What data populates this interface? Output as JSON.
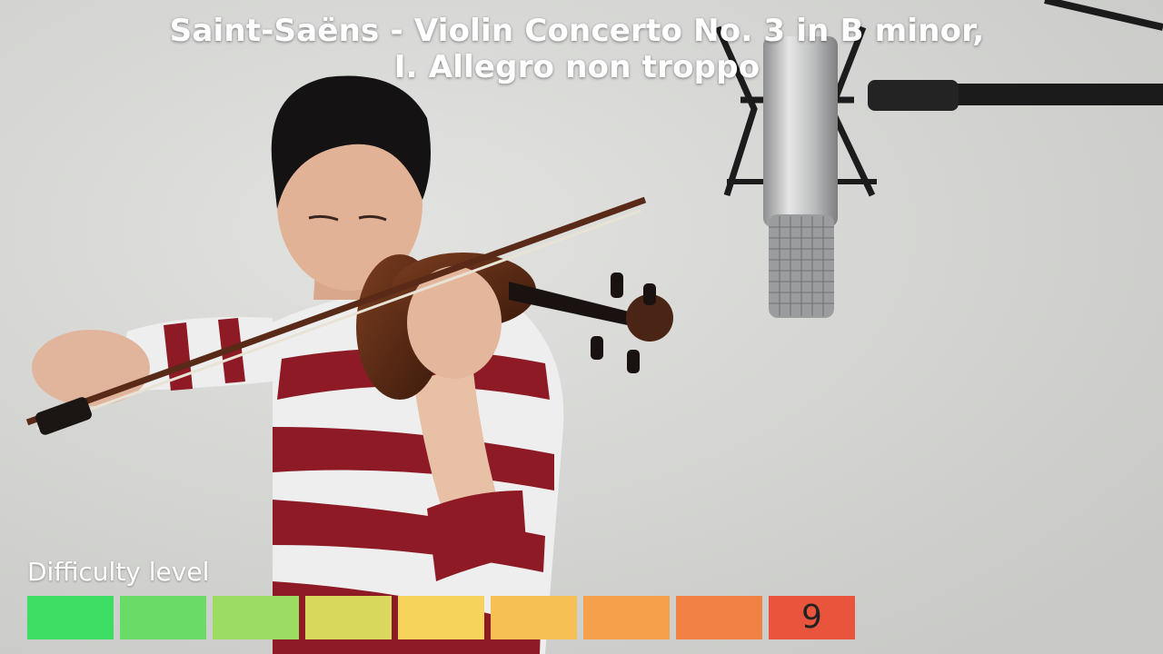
{
  "video": {
    "title_line1": "Saint-Saëns - Violin Concerto No. 3 in B minor,",
    "title_line2": "I. Allegro non troppo"
  },
  "difficulty": {
    "label": "Difficulty level",
    "level": 9,
    "level_text": "9",
    "max_level": 9,
    "segment_colors": [
      "#3ddc62",
      "#6bdb67",
      "#9cdc62",
      "#d8d95c",
      "#f6d45c",
      "#f7c055",
      "#f5a04b",
      "#f28244",
      "#e9553c"
    ]
  }
}
